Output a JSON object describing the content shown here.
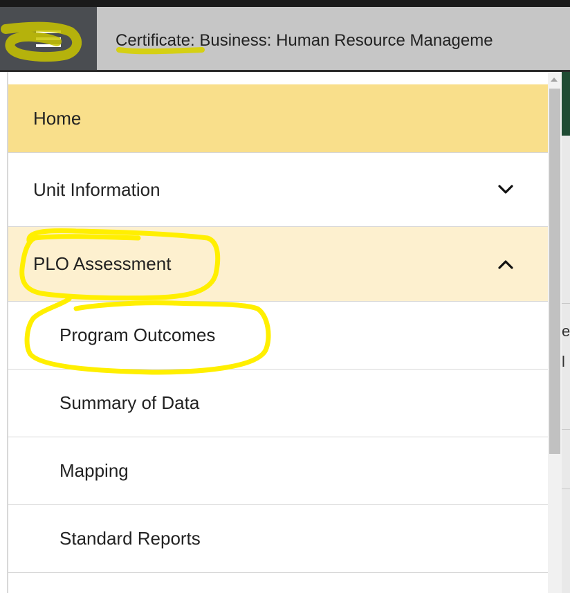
{
  "header": {
    "title": "Certificate: Business: Human Resource Manageme",
    "menu_icon": "hamburger-menu-icon"
  },
  "background": {
    "partial_text_1": "e",
    "partial_text_2": "l"
  },
  "menu": {
    "items": [
      {
        "label": "Home",
        "level": "top",
        "state": "active"
      },
      {
        "label": "Unit Information",
        "level": "top",
        "icon": "chevron-down-icon"
      },
      {
        "label": "PLO Assessment",
        "level": "top",
        "state": "expanded",
        "icon": "chevron-up-icon"
      },
      {
        "label": "Program Outcomes",
        "level": "sub"
      },
      {
        "label": "Summary of Data",
        "level": "sub"
      },
      {
        "label": "Mapping",
        "level": "sub"
      },
      {
        "label": "Standard Reports",
        "level": "sub"
      }
    ]
  },
  "colors": {
    "active_bg": "#f9df8b",
    "expanded_bg": "#fdf0cf",
    "header_bg": "#c6c6c6",
    "menu_button_bg": "#4a4d51",
    "highlighter": "#ffef00"
  }
}
